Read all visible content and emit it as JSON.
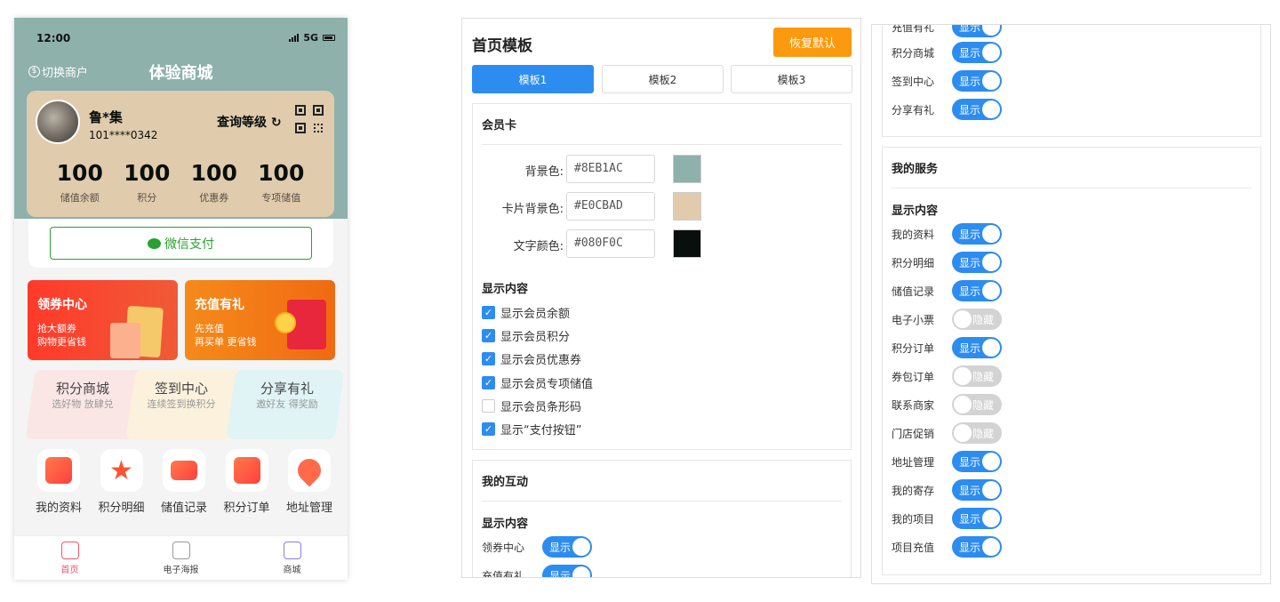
{
  "phone": {
    "status": {
      "time": "12:00",
      "network": "5G"
    },
    "switch_label": "切换商户",
    "shop_title": "体验商城",
    "card": {
      "name": "鲁*集",
      "id": "101****0342",
      "level_label": "查询等级",
      "stats": [
        {
          "value": "100",
          "label": "储值余额"
        },
        {
          "value": "100",
          "label": "积分"
        },
        {
          "value": "100",
          "label": "优惠券"
        },
        {
          "value": "100",
          "label": "专项储值"
        }
      ]
    },
    "pay_label": "微信支付",
    "promos": [
      {
        "title": "领券中心",
        "line1": "抢大额券",
        "line2": "购物更省钱"
      },
      {
        "title": "充值有礼",
        "line1": "先充值",
        "line2": "再买单 更省钱"
      }
    ],
    "tabs3": [
      {
        "title": "积分商城",
        "sub": "选好物 放肆兑"
      },
      {
        "title": "签到中心",
        "sub": "连续签到换积分"
      },
      {
        "title": "分享有礼",
        "sub": "邀好友 得奖励"
      }
    ],
    "icons": [
      "我的资料",
      "积分明细",
      "储值记录",
      "积分订单",
      "地址管理"
    ],
    "tabbar": [
      "首页",
      "电子海报",
      "商城"
    ]
  },
  "settings": {
    "title": "首页模板",
    "reset_label": "恢复默认",
    "templates": [
      "模板1",
      "模板2",
      "模板3"
    ],
    "member_card": {
      "heading": "会员卡",
      "colors": [
        {
          "label": "背景色:",
          "value": "#8EB1AC"
        },
        {
          "label": "卡片背景色:",
          "value": "#E0CBAD"
        },
        {
          "label": "文字颜色:",
          "value": "#080F0C"
        }
      ],
      "content_heading": "显示内容",
      "options": [
        {
          "label": "显示会员余额",
          "checked": true
        },
        {
          "label": "显示会员积分",
          "checked": true
        },
        {
          "label": "显示会员优惠券",
          "checked": true
        },
        {
          "label": "显示会员专项储值",
          "checked": true
        },
        {
          "label": "显示会员条形码",
          "checked": false
        },
        {
          "label": "显示“支付按钮”",
          "checked": true
        }
      ]
    },
    "interaction": {
      "heading": "我的互动",
      "content_heading": "显示内容",
      "items": [
        {
          "label": "领券中心",
          "state": "显示",
          "on": true
        },
        {
          "label": "充值有礼",
          "state": "显示",
          "on": true
        },
        {
          "label": "积分商城",
          "state": "显示",
          "on": true
        },
        {
          "label": "签到中心",
          "state": "显示",
          "on": true
        },
        {
          "label": "分享有礼",
          "state": "显示",
          "on": true
        }
      ]
    },
    "services": {
      "heading": "我的服务",
      "content_heading": "显示内容",
      "items": [
        {
          "label": "我的资料",
          "state": "显示",
          "on": true
        },
        {
          "label": "积分明细",
          "state": "显示",
          "on": true
        },
        {
          "label": "储值记录",
          "state": "显示",
          "on": true
        },
        {
          "label": "电子小票",
          "state": "隐藏",
          "on": false
        },
        {
          "label": "积分订单",
          "state": "显示",
          "on": true
        },
        {
          "label": "券包订单",
          "state": "隐藏",
          "on": false
        },
        {
          "label": "联系商家",
          "state": "隐藏",
          "on": false
        },
        {
          "label": "门店促销",
          "state": "隐藏",
          "on": false
        },
        {
          "label": "地址管理",
          "state": "显示",
          "on": true
        },
        {
          "label": "我的寄存",
          "state": "显示",
          "on": true
        },
        {
          "label": "我的项目",
          "state": "显示",
          "on": true
        },
        {
          "label": "项目充值",
          "state": "显示",
          "on": true
        }
      ]
    }
  }
}
